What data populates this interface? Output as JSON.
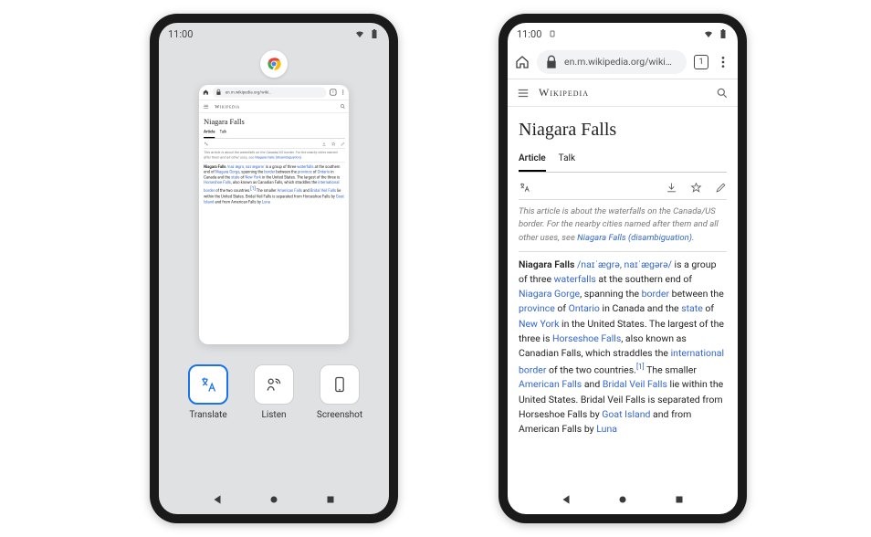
{
  "status": {
    "time": "11:00"
  },
  "overview": {
    "actions": [
      {
        "label": "Translate",
        "icon": "translate-icon",
        "selected": true
      },
      {
        "label": "Listen",
        "icon": "listen-icon",
        "selected": false
      },
      {
        "label": "Screenshot",
        "icon": "screenshot-icon",
        "selected": false
      }
    ]
  },
  "chrome": {
    "url_display": "en.m.wikipedia.org/wiki…",
    "tab_count": "1"
  },
  "wiki": {
    "brand": "Wikipedia",
    "title": "Niagara Falls",
    "tabs": {
      "article": "Article",
      "talk": "Talk"
    },
    "hatnote_prefix": "This article is about the waterfalls on the Canada/US border. For the nearby cities named after them and all other uses, see ",
    "hatnote_link": "Niagara Falls (disambiguation)",
    "hatnote_suffix": ".",
    "para": {
      "t1": "Niagara Falls",
      "ipa": " /naɪˈæɡrə, naɪˈæɡərə/",
      "t2": " is a group of three ",
      "l1": "waterfalls",
      "t3": " at the southern end of ",
      "l2": "Niagara Gorge",
      "t4": ", spanning the ",
      "l3": "border",
      "t5": " between the ",
      "l4": "province",
      "t6": " of ",
      "l5": "Ontario",
      "t7": " in Canada and the ",
      "l6": "state",
      "t8": " of ",
      "l7": "New York",
      "t9": " in the United States. The largest of the three is ",
      "l8": "Horseshoe Falls",
      "t10": ", also known as Canadian Falls, which straddles the ",
      "l9": "international border",
      "t11": " of the two countries.",
      "ref": "[1]",
      "t12": " The smaller ",
      "l10": "American Falls",
      "t13": " and ",
      "l11": "Bridal Veil Falls",
      "t14": " lie within the United States. Bridal Veil Falls is separated from Horseshoe Falls by ",
      "l12": "Goat Island",
      "t15": " and from American Falls by ",
      "l13": "Luna"
    }
  }
}
